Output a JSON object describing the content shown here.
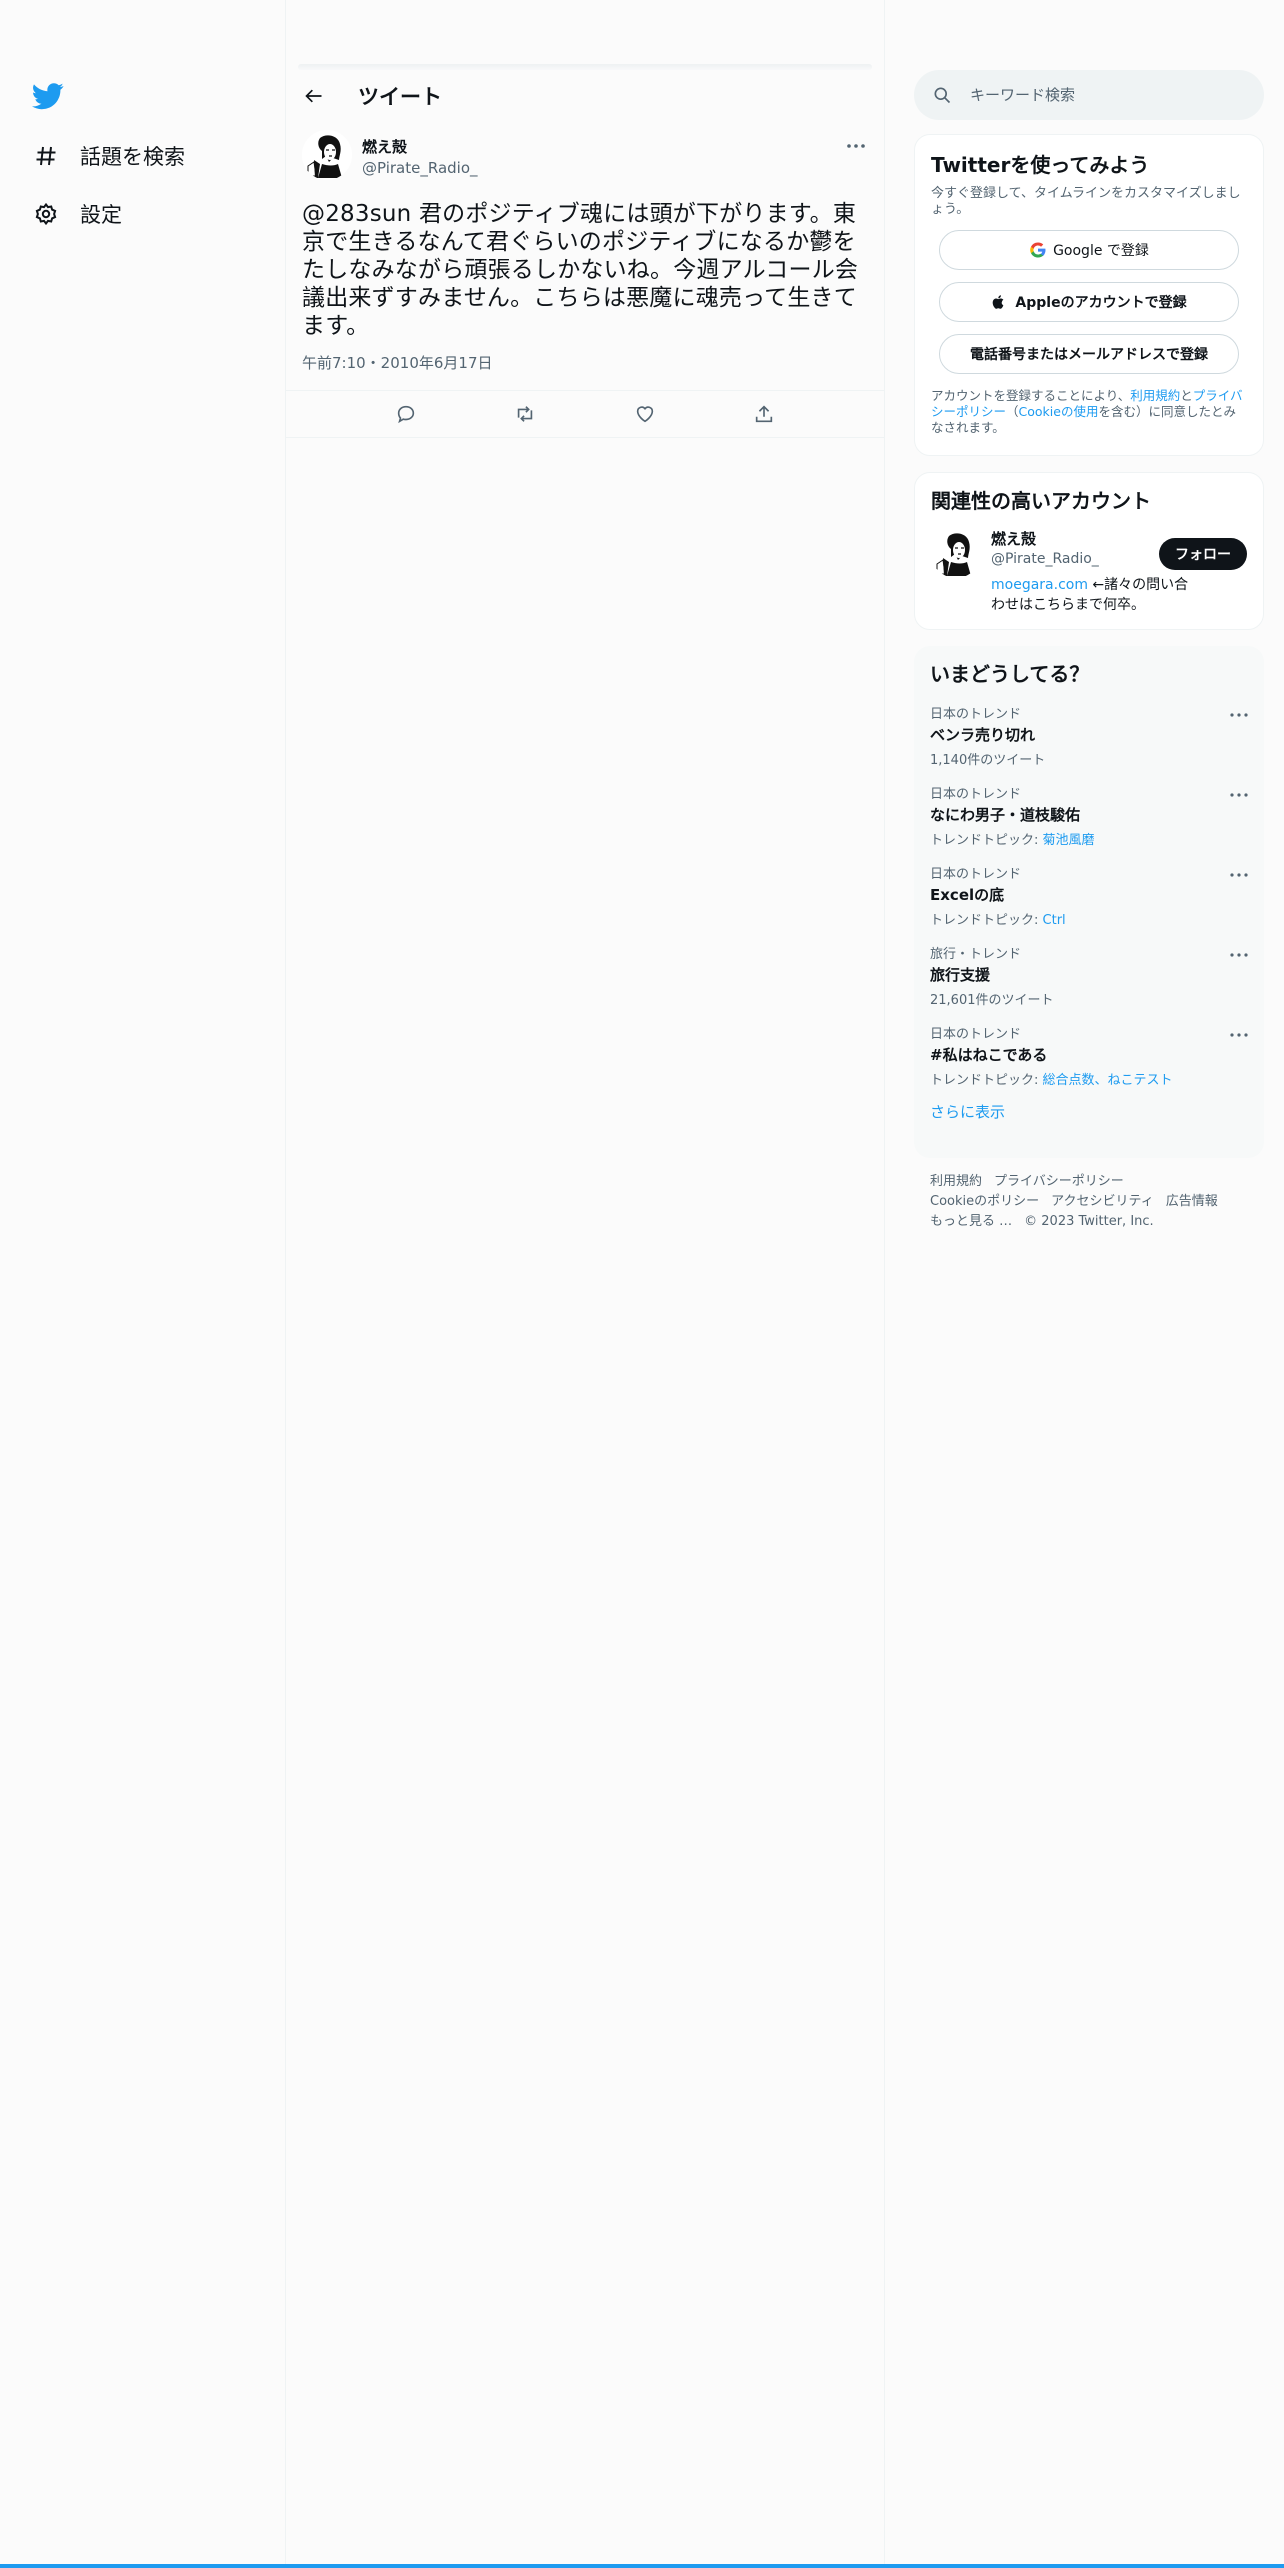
{
  "nav": {
    "logo": "twitter-bird-icon",
    "explore": "話題を検索",
    "settings": "設定"
  },
  "header": {
    "title": "ツイート"
  },
  "tweet": {
    "author_name": "燃え殻",
    "author_handle": "@Pirate_Radio_",
    "text": "@283sun 君のポジティブ魂には頭が下がります。東京で生きるなんて君ぐらいのポジティブになるか鬱をたしなみながら頑張るしかないね。今週アルコール会議出来ずすみません。こちらは悪魔に魂売って生きてます。",
    "time": "午前7:10・2010年6月17日"
  },
  "search": {
    "placeholder": "キーワード検索"
  },
  "signup": {
    "title": "Twitterを使ってみよう",
    "subtitle": "今すぐ登録して、タイムラインをカスタマイズしましょう。",
    "google": "Google で登録",
    "apple": "Appleのアカウントで登録",
    "phone": "電話番号またはメールアドレスで登録",
    "terms_pre": "アカウントを登録することにより、",
    "terms_link": "利用規約",
    "terms_and": "と",
    "privacy_link": "プライバシーポリシー",
    "paren_open": "（",
    "cookie_link": "Cookieの使用",
    "terms_post": "を含む）に同意したとみなされます。"
  },
  "related": {
    "title": "関連性の高いアカウント",
    "name": "燃え殻",
    "handle": "@Pirate_Radio_",
    "bio_link": "moegara.com",
    "bio_text": " ←諸々の問い合わせはこちらまで何卒。",
    "follow": "フォロー"
  },
  "trends": {
    "title": "いまどうしてる？",
    "items": [
      {
        "category": "日本のトレンド",
        "name": "ベンラ売り切れ",
        "meta": "1,140件のツイート",
        "link": ""
      },
      {
        "category": "日本のトレンド",
        "name": "なにわ男子・道枝駿佑",
        "meta": "トレンドトピック: ",
        "link": "菊池風磨"
      },
      {
        "category": "日本のトレンド",
        "name": "Excelの底",
        "meta": "トレンドトピック: ",
        "link": "Ctrl"
      },
      {
        "category": "旅行・トレンド",
        "name": "旅行支援",
        "meta": "21,601件のツイート",
        "link": ""
      },
      {
        "category": "日本のトレンド",
        "name": "#私はねこである",
        "meta": "トレンドトピック: ",
        "link": "総合点数、ねこテスト"
      }
    ],
    "show_more": "さらに表示"
  },
  "footer": {
    "terms": "利用規約",
    "privacy": "プライバシーポリシー",
    "cookie": "Cookieのポリシー",
    "accessibility": "アクセシビリティ",
    "ads": "広告情報",
    "more": "もっと見る …",
    "copyright": "© 2023 Twitter, Inc."
  },
  "colors": {
    "accent": "#1d9bf0",
    "text": "#0f1419",
    "secondary": "#536471"
  }
}
